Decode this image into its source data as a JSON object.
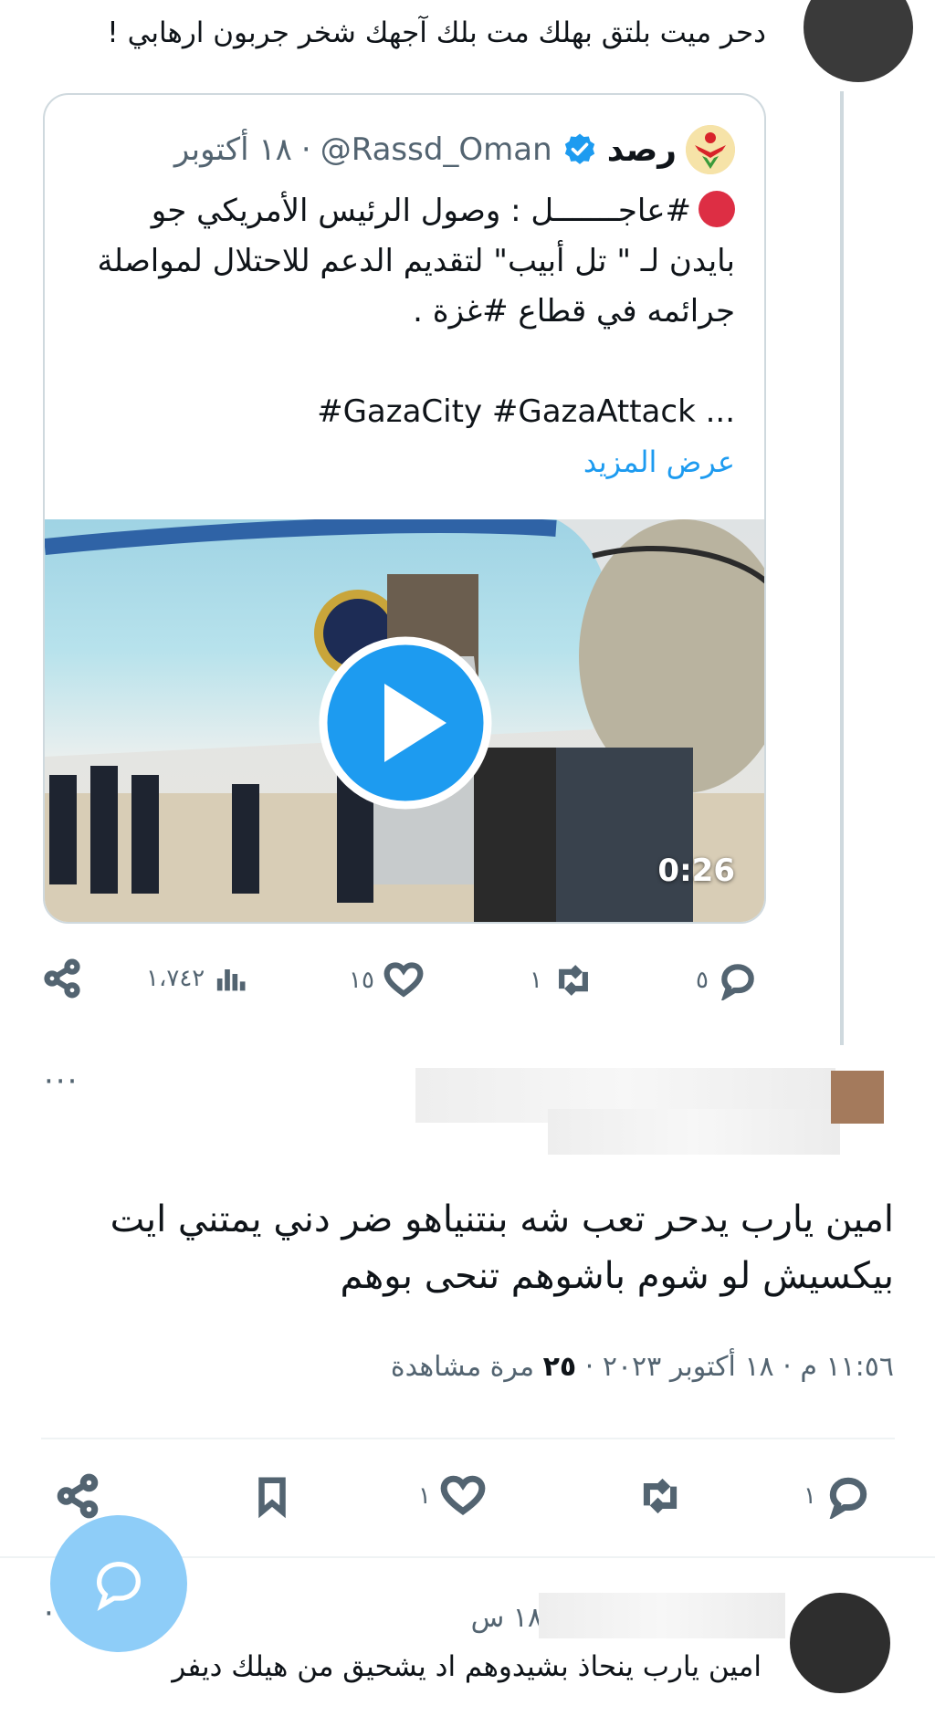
{
  "parent_reply": {
    "text": "دحر ميت بلتق بهلك مت بلك آجهك شخر جربون ارهابي !"
  },
  "quoted_tweet": {
    "name": "رصد",
    "handle": "@Rassd_Oman",
    "separator": "·",
    "date": "١٨ أكتوبر",
    "line1": "#عاجـــــــل : وصول الرئيس الأمريكي جو",
    "line2": "بايدن لـ \" تل أبيب\" لتقديم الدعم للاحتلال لمواصلة",
    "line3": "جرائمه في قطاع #غزة .",
    "hashtags": "#GazaCity #GazaAttack ...",
    "show_more": "عرض المزيد",
    "video_duration": "0:26"
  },
  "parent_actions": {
    "replies": "٥",
    "retweets": "١",
    "likes": "١٥",
    "views": "١،٧٤٢"
  },
  "reply": {
    "more": "···",
    "line1": "امين يارب يدحر تعب شه بنتنياهو ضر دني يمتني ايت",
    "line2": "بيكسيش لو شوم باشوهم تنحى بوهم",
    "time": "١١:٥٦ م",
    "date": "١٨ أكتوبر ٢٠٢٣",
    "views_count": "٢٥",
    "views_label": "مرة مشاهدة",
    "separator": "·"
  },
  "reply_actions": {
    "replies": "١",
    "likes": "١"
  },
  "next_reply": {
    "time": "١٨ س",
    "text": "امين يارب ينحاذ بشيدوهم اد يشحيق من هيلك ديفر",
    "more": "···"
  },
  "colors": {
    "accent": "#1d9bf0",
    "text": "#0f1419",
    "muted": "#536471",
    "border": "#cfd9de",
    "fab": "#8ecdf8"
  }
}
